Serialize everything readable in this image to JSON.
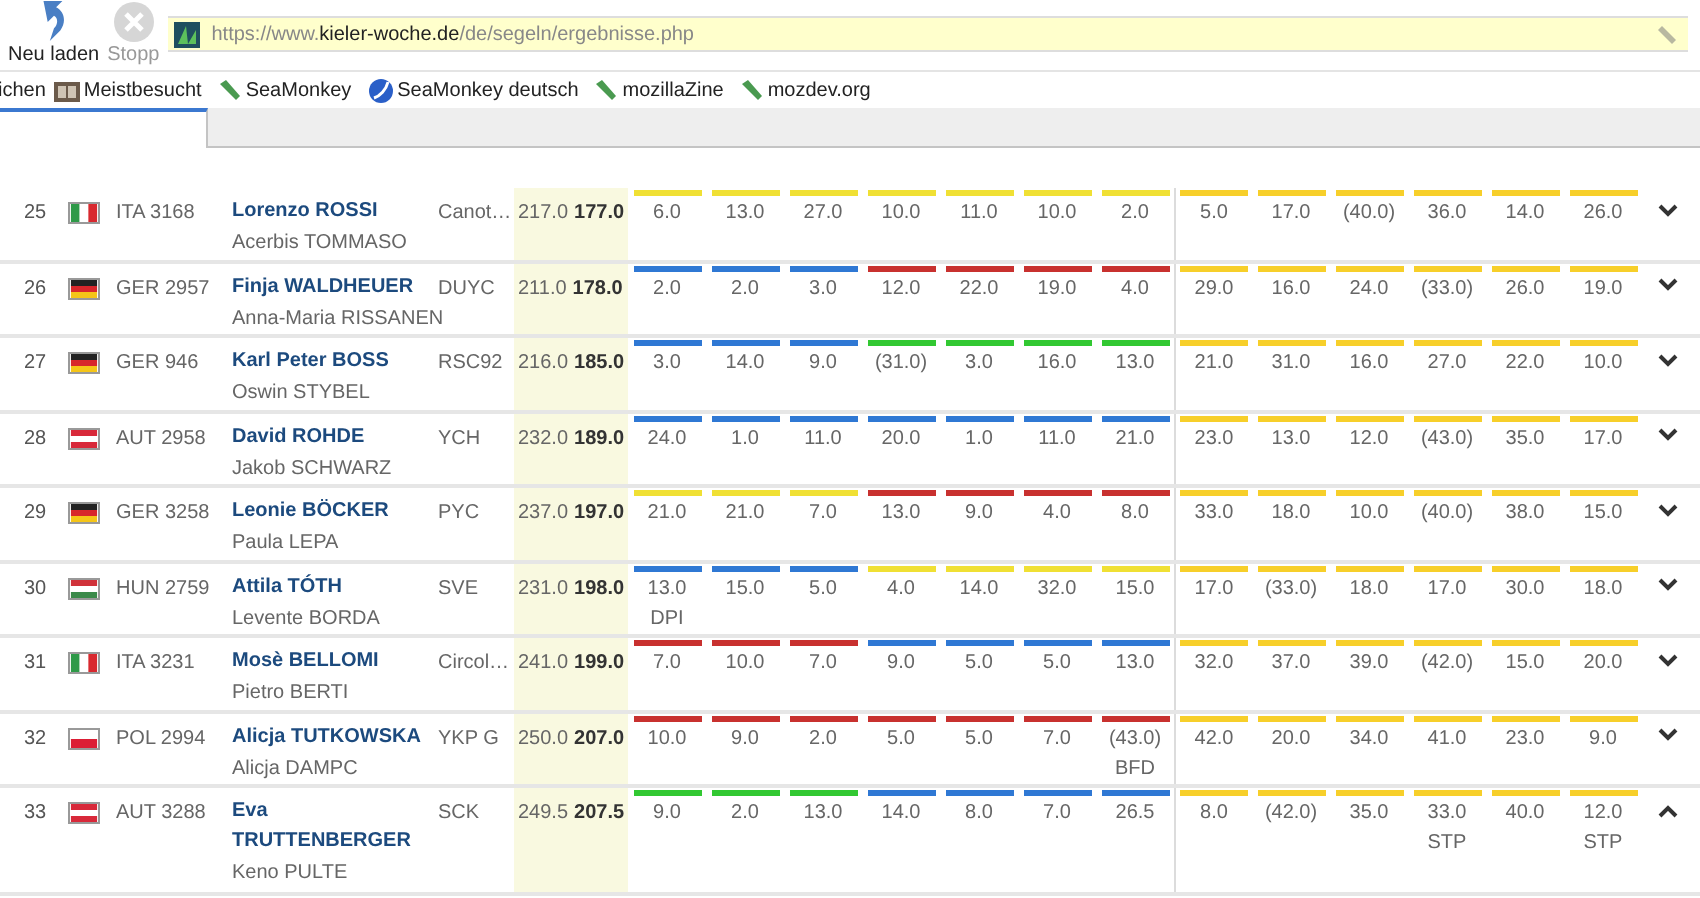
{
  "toolbar": {
    "buttons": [
      {
        "label": "Neu laden",
        "kind": "reload",
        "disabled": false
      },
      {
        "label": "Stopp",
        "kind": "stop",
        "disabled": true
      }
    ],
    "url": {
      "prefix": "https://www.",
      "domain": "kieler-woche.de",
      "path": "/de/segeln/ergebnisse.php"
    }
  },
  "bookmarks": [
    {
      "label": "ichen",
      "kind": "text"
    },
    {
      "label": "Meistbesucht",
      "kind": "folder"
    },
    {
      "label": "SeaMonkey",
      "kind": "leaf"
    },
    {
      "label": "SeaMonkey deutsch",
      "kind": "globe"
    },
    {
      "label": "mozillaZine",
      "kind": "leaf"
    },
    {
      "label": "mozdev.org",
      "kind": "leaf"
    }
  ],
  "tabs": [
    {
      "selected": true
    }
  ],
  "results": [
    {
      "rank": "25",
      "kind": "ita",
      "sail": "ITA 3168",
      "helm": "Lorenzo ROSSI",
      "crew": "Acerbis TOMMASO",
      "club": "Canot…",
      "total": "217.0",
      "net": "177.0",
      "expanded": false,
      "races": [
        {
          "score": "6.0",
          "color": "#f0e034"
        },
        {
          "score": "13.0",
          "color": "#f0e034"
        },
        {
          "score": "27.0",
          "color": "#f0e034"
        },
        {
          "score": "10.0",
          "color": "#f0e034"
        },
        {
          "score": "11.0",
          "color": "#f0e034"
        },
        {
          "score": "10.0",
          "color": "#f0e034"
        },
        {
          "score": "2.0",
          "color": "#f0e034"
        },
        {
          "score": "5.0",
          "color": "#f7cf2a"
        },
        {
          "score": "17.0",
          "color": "#f7cf2a"
        },
        {
          "score": "(40.0)",
          "color": "#f7cf2a"
        },
        {
          "score": "36.0",
          "color": "#f7cf2a"
        },
        {
          "score": "14.0",
          "color": "#f7cf2a"
        },
        {
          "score": "26.0",
          "color": "#f7cf2a"
        }
      ]
    },
    {
      "rank": "26",
      "kind": "ger",
      "sail": "GER 2957",
      "helm": "Finja WALDHEUER",
      "crew": "Anna-Maria RISSANEN",
      "club": "DUYC",
      "total": "211.0",
      "net": "178.0",
      "expanded": false,
      "races": [
        {
          "score": "2.0",
          "color": "#2f78d4"
        },
        {
          "score": "2.0",
          "color": "#2f78d4"
        },
        {
          "score": "3.0",
          "color": "#2f78d4"
        },
        {
          "score": "12.0",
          "color": "#c8312f"
        },
        {
          "score": "22.0",
          "color": "#c8312f"
        },
        {
          "score": "19.0",
          "color": "#c8312f"
        },
        {
          "score": "4.0",
          "color": "#c8312f"
        },
        {
          "score": "29.0",
          "color": "#f7cf2a"
        },
        {
          "score": "16.0",
          "color": "#f7cf2a"
        },
        {
          "score": "24.0",
          "color": "#f7cf2a"
        },
        {
          "score": "(33.0)",
          "color": "#f7cf2a"
        },
        {
          "score": "26.0",
          "color": "#f7cf2a"
        },
        {
          "score": "19.0",
          "color": "#f7cf2a"
        }
      ]
    },
    {
      "rank": "27",
      "kind": "ger",
      "sail": "GER 946",
      "helm": "Karl Peter BOSS",
      "crew": "Oswin STYBEL",
      "club": "RSC92",
      "total": "216.0",
      "net": "185.0",
      "expanded": false,
      "races": [
        {
          "score": "3.0",
          "color": "#2f78d4"
        },
        {
          "score": "14.0",
          "color": "#2f78d4"
        },
        {
          "score": "9.0",
          "color": "#2f78d4"
        },
        {
          "score": "(31.0)",
          "color": "#32c832"
        },
        {
          "score": "3.0",
          "color": "#32c832"
        },
        {
          "score": "16.0",
          "color": "#32c832"
        },
        {
          "score": "13.0",
          "color": "#32c832"
        },
        {
          "score": "21.0",
          "color": "#f7cf2a"
        },
        {
          "score": "31.0",
          "color": "#f7cf2a"
        },
        {
          "score": "16.0",
          "color": "#f7cf2a"
        },
        {
          "score": "27.0",
          "color": "#f7cf2a"
        },
        {
          "score": "22.0",
          "color": "#f7cf2a"
        },
        {
          "score": "10.0",
          "color": "#f7cf2a"
        }
      ]
    },
    {
      "rank": "28",
      "kind": "aut",
      "sail": "AUT 2958",
      "helm": "David ROHDE",
      "crew": "Jakob SCHWARZ",
      "club": "YCH",
      "total": "232.0",
      "net": "189.0",
      "expanded": false,
      "races": [
        {
          "score": "24.0",
          "color": "#2f78d4"
        },
        {
          "score": "1.0",
          "color": "#2f78d4"
        },
        {
          "score": "11.0",
          "color": "#2f78d4"
        },
        {
          "score": "20.0",
          "color": "#2f78d4"
        },
        {
          "score": "1.0",
          "color": "#2f78d4"
        },
        {
          "score": "11.0",
          "color": "#2f78d4"
        },
        {
          "score": "21.0",
          "color": "#2f78d4"
        },
        {
          "score": "23.0",
          "color": "#f7cf2a"
        },
        {
          "score": "13.0",
          "color": "#f7cf2a"
        },
        {
          "score": "12.0",
          "color": "#f7cf2a"
        },
        {
          "score": "(43.0)",
          "color": "#f7cf2a"
        },
        {
          "score": "35.0",
          "color": "#f7cf2a"
        },
        {
          "score": "17.0",
          "color": "#f7cf2a"
        }
      ]
    },
    {
      "rank": "29",
      "kind": "ger",
      "sail": "GER 3258",
      "helm": "Leonie BÖCKER",
      "crew": "Paula LEPA",
      "club": "PYC",
      "total": "237.0",
      "net": "197.0",
      "expanded": false,
      "races": [
        {
          "score": "21.0",
          "color": "#f0e034"
        },
        {
          "score": "21.0",
          "color": "#f0e034"
        },
        {
          "score": "7.0",
          "color": "#f0e034"
        },
        {
          "score": "13.0",
          "color": "#c8312f"
        },
        {
          "score": "9.0",
          "color": "#c8312f"
        },
        {
          "score": "4.0",
          "color": "#c8312f"
        },
        {
          "score": "8.0",
          "color": "#c8312f"
        },
        {
          "score": "33.0",
          "color": "#f7cf2a"
        },
        {
          "score": "18.0",
          "color": "#f7cf2a"
        },
        {
          "score": "10.0",
          "color": "#f7cf2a"
        },
        {
          "score": "(40.0)",
          "color": "#f7cf2a"
        },
        {
          "score": "38.0",
          "color": "#f7cf2a"
        },
        {
          "score": "15.0",
          "color": "#f7cf2a"
        }
      ]
    },
    {
      "rank": "30",
      "kind": "hun",
      "sail": "HUN 2759",
      "helm": "Attila TÓTH",
      "crew": "Levente BORDA",
      "club": "SVE",
      "total": "231.0",
      "net": "198.0",
      "expanded": false,
      "races": [
        {
          "score": "13.0",
          "note": "DPI",
          "color": "#2f78d4"
        },
        {
          "score": "15.0",
          "color": "#2f78d4"
        },
        {
          "score": "5.0",
          "color": "#2f78d4"
        },
        {
          "score": "4.0",
          "color": "#f0e034"
        },
        {
          "score": "14.0",
          "color": "#f0e034"
        },
        {
          "score": "32.0",
          "color": "#f0e034"
        },
        {
          "score": "15.0",
          "color": "#f0e034"
        },
        {
          "score": "17.0",
          "color": "#f7cf2a"
        },
        {
          "score": "(33.0)",
          "color": "#f7cf2a"
        },
        {
          "score": "18.0",
          "color": "#f7cf2a"
        },
        {
          "score": "17.0",
          "color": "#f7cf2a"
        },
        {
          "score": "30.0",
          "color": "#f7cf2a"
        },
        {
          "score": "18.0",
          "color": "#f7cf2a"
        }
      ]
    },
    {
      "rank": "31",
      "kind": "ita",
      "sail": "ITA 3231",
      "helm": "Mosè BELLOMI",
      "crew": "Pietro BERTI",
      "club": "Circol…",
      "total": "241.0",
      "net": "199.0",
      "expanded": false,
      "races": [
        {
          "score": "7.0",
          "color": "#c8312f"
        },
        {
          "score": "10.0",
          "color": "#c8312f"
        },
        {
          "score": "7.0",
          "color": "#c8312f"
        },
        {
          "score": "9.0",
          "color": "#2f78d4"
        },
        {
          "score": "5.0",
          "color": "#2f78d4"
        },
        {
          "score": "5.0",
          "color": "#2f78d4"
        },
        {
          "score": "13.0",
          "color": "#2f78d4"
        },
        {
          "score": "32.0",
          "color": "#f7cf2a"
        },
        {
          "score": "37.0",
          "color": "#f7cf2a"
        },
        {
          "score": "39.0",
          "color": "#f7cf2a"
        },
        {
          "score": "(42.0)",
          "color": "#f7cf2a"
        },
        {
          "score": "15.0",
          "color": "#f7cf2a"
        },
        {
          "score": "20.0",
          "color": "#f7cf2a"
        }
      ]
    },
    {
      "rank": "32",
      "kind": "pol",
      "sail": "POL 2994",
      "helm": "Alicja TUTKOWSKA",
      "crew": "Alicja DAMPC",
      "club": "YKP G",
      "total": "250.0",
      "net": "207.0",
      "expanded": false,
      "races": [
        {
          "score": "10.0",
          "color": "#c8312f"
        },
        {
          "score": "9.0",
          "color": "#c8312f"
        },
        {
          "score": "2.0",
          "color": "#c8312f"
        },
        {
          "score": "5.0",
          "color": "#c8312f"
        },
        {
          "score": "5.0",
          "color": "#c8312f"
        },
        {
          "score": "7.0",
          "color": "#c8312f"
        },
        {
          "score": "(43.0)",
          "note": "BFD",
          "color": "#c8312f"
        },
        {
          "score": "42.0",
          "color": "#f7cf2a"
        },
        {
          "score": "20.0",
          "color": "#f7cf2a"
        },
        {
          "score": "34.0",
          "color": "#f7cf2a"
        },
        {
          "score": "41.0",
          "color": "#f7cf2a"
        },
        {
          "score": "23.0",
          "color": "#f7cf2a"
        },
        {
          "score": "9.0",
          "color": "#f7cf2a"
        }
      ]
    },
    {
      "rank": "33",
      "kind": "aut",
      "sail": "AUT 3288",
      "helm": "Eva TRUTTENBERGER",
      "crew": "Keno PULTE",
      "club": "SCK",
      "total": "249.5",
      "net": "207.5",
      "expanded": true,
      "races": [
        {
          "score": "9.0",
          "color": "#32c832"
        },
        {
          "score": "2.0",
          "color": "#32c832"
        },
        {
          "score": "13.0",
          "color": "#32c832"
        },
        {
          "score": "14.0",
          "color": "#2f78d4"
        },
        {
          "score": "8.0",
          "color": "#2f78d4"
        },
        {
          "score": "7.0",
          "color": "#2f78d4"
        },
        {
          "score": "26.5",
          "color": "#2f78d4"
        },
        {
          "score": "8.0",
          "color": "#f7cf2a"
        },
        {
          "score": "(42.0)",
          "color": "#f7cf2a"
        },
        {
          "score": "35.0",
          "color": "#f7cf2a"
        },
        {
          "score": "33.0",
          "note": "STP",
          "color": "#f7cf2a"
        },
        {
          "score": "40.0",
          "color": "#f7cf2a"
        },
        {
          "score": "12.0",
          "note": "STP",
          "color": "#f7cf2a"
        }
      ]
    }
  ]
}
